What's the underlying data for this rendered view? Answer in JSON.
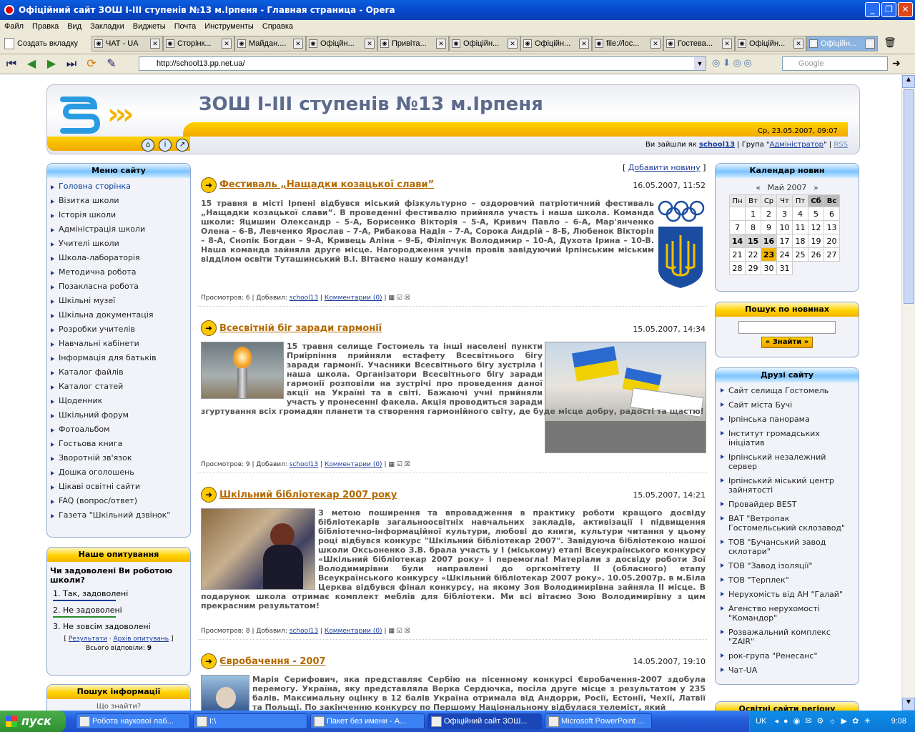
{
  "window": {
    "title": "Офіційний сайт ЗОШ I-III ступенів №13 м.Ірпеня - Главная страница - Opera"
  },
  "menubar": [
    "Файл",
    "Правка",
    "Вид",
    "Закладки",
    "Виджеты",
    "Почта",
    "Инструменты",
    "Справка"
  ],
  "tabs": {
    "new_tab": "Создать вкладку",
    "items": [
      "ЧАТ - UA",
      "Сторінк...",
      "Майдан....",
      "Офіцйн...",
      "Привіта...",
      "Офіційн...",
      "Офіційн...",
      "file://loc...",
      "Гостева...",
      "Офіційн...",
      "Офіційн..."
    ]
  },
  "nav": {
    "url": "http://school13.pp.net.ua/",
    "search_placeholder": "Google"
  },
  "site": {
    "title": "ЗОШ І-ІІІ ступенів №13 м.Ірпеня",
    "datetime": "Ср, 23.05.2007, 09:07",
    "login_prefix": "Ви зайшли як",
    "user": "school13",
    "group_prefix": "| Група \"",
    "group": "Адміністратор",
    "group_suffix": "\" |",
    "rss": "RSS",
    "add_news": "Добавити новину"
  },
  "site_menu": {
    "title": "Меню сайту",
    "items": [
      "Головна сторінка",
      "Візитка школи",
      "Історія школи",
      "Адміністрація школи",
      "Учителі школи",
      "Школа-лабораторія",
      "Методична робота",
      "Позакласна робота",
      "Шкільні музеї",
      "Шкільна документація",
      "Розробки учителів",
      "Навчальні кабінети",
      "Інформація для батьків",
      "Каталог файлів",
      "Каталог статей",
      "Щоденник",
      "Шкільний форум",
      "Фотоальбом",
      "Гостьова книга",
      "Зворотній зв'язок",
      "Дошка оголошень",
      "Цікаві освітні сайти",
      "FAQ (вопрос/ответ)",
      "Газета \"Шкільний дзвінок\""
    ]
  },
  "poll": {
    "title": "Наше опитування",
    "question": "Чи задоволені Ви роботою школи?",
    "options": [
      "1. Так, задоволені",
      "2. Не задоволені",
      "3. Не зовсім задоволені"
    ],
    "results": "Результати",
    "archive": "Архів опитувань",
    "total": "Всього відповіли:",
    "total_value": "9"
  },
  "info_search": {
    "title": "Пошук інформації",
    "sub": "Що знайти?"
  },
  "news": [
    {
      "title": "Фестиваль „Нащадки козацької слави”",
      "date": "16.05.2007, 11:52",
      "body": "15 травня в місті Ірпені відбувся міський фізкультурно – оздоровчий патріотичний фестиваль „Нащадки козацької слави”. В проведенні фестивалю прийняла участь і наша школа. Команда школи: Яцишин Олександр – 5-А, Борисенко Вікторія – 5-А, Кривич Павло – 6-А, Мар'янченко Олена – 6-В, Левченко Ярослав – 7-А, Рибакова Надія – 7-А, Сорока Андрій – 8-Б, Любенок Вікторія – 8-А, Снопік Богдан – 9-А, Кривець Аліна – 9-Б, Філіпчук Володимир – 10-А, Духота Ірина – 10-В. Наша команда зайняла друге місце. Нагородження учнів провів завідуючий Ірпінським міським відділом освіти Туташинський В.І. Вітаємо нашу команду!",
      "views": "Просмотров: 6",
      "added": "| Добавил:",
      "author": "school13",
      "comments": "Комментарии (0)"
    },
    {
      "title": "Всесвітній біг заради гармонії",
      "date": "15.05.2007, 14:34",
      "body": "15 травня селище Гостомель та інші населені пункти Приірпіння прийняли естафету Всесвітнього бігу заради гармонії. Учасники Всесвітнього бігу зустріла і наша школа. Організатори Всесвітнього бігу заради гармонії розповіли на зустрічі про проведення даної акції на Україні та в світі. Бажаючі учні прийняли участь у пронесенні факела. Акція проводиться заради згуртування всіх громадян планети та створення гармонійного світу, де буде місце добру, радості та щастю!",
      "views": "Просмотров: 9",
      "added": "| Добавил:",
      "author": "school13",
      "comments": "Комментарии (0)"
    },
    {
      "title": "Шкільний бібліотекар 2007 року",
      "date": "15.05.2007, 14:21",
      "body": "З метою поширення та впровадження в практику роботи кращого досвіду бібліотекарів загальноосвітніх навчальних закладів, активізації і підвищення бібліотечно-інформаційної культури, любові до книги, культури читання у цьому році відбувся конкурс \"Шкільний бібліотекар 2007\". Завідуюча бібліотекою нашої школи Оксьоненко З.В. брала участь у І (міському) етапі Всеукраїнського конкурсу «Шкільний бібліотекар 2007 року» і перемогла! Матеріали з досвіду роботи Зої Володимирівни були направлені до оргкомітету ІІ (обласного) етапу Всеукраїнського конкурсу «Шкільний бібліотекар 2007 року». 10.05.2007р. в м.Біла Церква відбувся фінал конкурсу, на якому Зоя Володимирівна зайняла ІІ місце. В подарунок школа отримає комплект меблів для бібліотеки. Ми всі вітаємо Зою Володимирівну з цим прекрасним результатом!",
      "views": "Просмотров: 8",
      "added": "| Добавил:",
      "author": "school13",
      "comments": "Комментарии (0)"
    },
    {
      "title": "Євробачення - 2007",
      "date": "14.05.2007, 19:10",
      "body": "Марія Серифович, яка представляє Сербію на пісенному конкурсі Євробачення-2007 здобула перемогу. Україна, яку представляла Верка Сердючка, посіла друге місце з результатом у 235 балів. Максимальну оцінку в 12 балів Україна отримала від Андорри, Росії, Естонії, Чехії, Латвії та Польщі. По закінченню конкурсу по Першому Національному відбулася телеміст, який"
    }
  ],
  "calendar": {
    "title": "Календар новин",
    "month": "Май 2007",
    "prev": "«",
    "next": "»",
    "weekdays": [
      "Пн",
      "Вт",
      "Ср",
      "Чт",
      "Пт",
      "Сб",
      "Вс"
    ],
    "days": [
      "",
      "1",
      "2",
      "3",
      "4",
      "5",
      "6",
      "7",
      "8",
      "9",
      "10",
      "11",
      "12",
      "13",
      "14",
      "15",
      "16",
      "17",
      "18",
      "19",
      "20",
      "21",
      "22",
      "23",
      "24",
      "25",
      "26",
      "27",
      "28",
      "29",
      "30",
      "31"
    ]
  },
  "news_search": {
    "title": "Пошук по новинах",
    "button": "« Знайти »"
  },
  "friends": {
    "title": "Друзі сайту",
    "items": [
      "Сайт селища Гостомель",
      "Сайт міста Бучі",
      "Ірпінська панорама",
      "Інститут громадських ініціатив",
      "Ірпінський незалежний сервер",
      "Ірпінський міський центр зайнятості",
      "Провайдер BEST",
      "ВАТ \"Ветропак Гостомельський склозавод\"",
      "ТОВ \"Бучанський завод склотари\"",
      "ТОВ \"Завод ізоляції\"",
      "ТОВ \"Терплек\"",
      "Нерухомість від АН \"Галай\"",
      "Агенство нерухомості \"Командор\"",
      "Розважальний комплекс \"ZAIR\"",
      "рок-група \"Ренесанс\"",
      "Чат-UA"
    ]
  },
  "edu_sites": {
    "title": "Освітні сайти регіону"
  },
  "taskbar": {
    "start": "пуск",
    "tasks": [
      "Робота наукової лаб...",
      "I:\\",
      "Пакет без имени - А...",
      "Офіційний сайт ЗОШ...",
      "Microsoft PowerPoint ..."
    ],
    "lang": "UK",
    "clock": "9:08"
  }
}
